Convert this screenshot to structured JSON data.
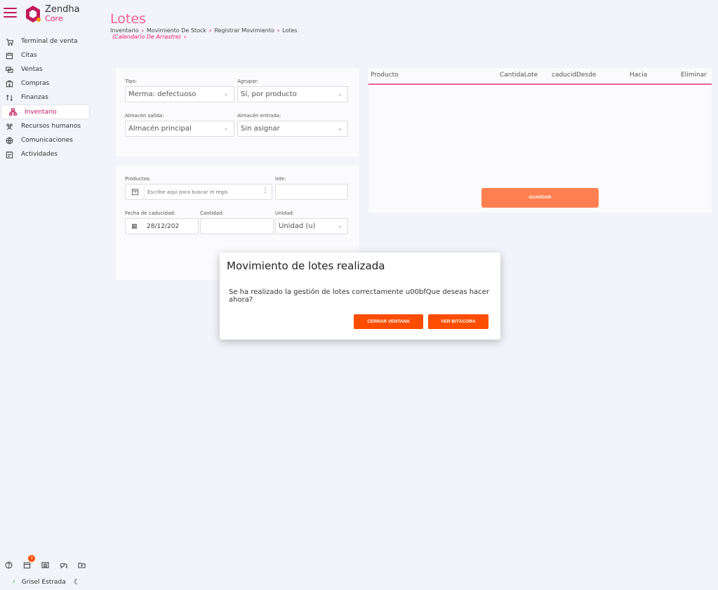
{
  "brand": {
    "name": "Zendha",
    "sub": "Core"
  },
  "nav": [
    {
      "label": "Terminal de venta",
      "icon": "cart-icon"
    },
    {
      "label": "Citas",
      "icon": "calendar-icon"
    },
    {
      "label": "Ventas",
      "icon": "sales-icon"
    },
    {
      "label": "Compras",
      "icon": "purchase-icon"
    },
    {
      "label": "Finanzas",
      "icon": "finance-icon"
    },
    {
      "label": "Inventario",
      "icon": "inventory-icon",
      "active": true
    },
    {
      "label": "Recursos humanos",
      "icon": "people-icon"
    },
    {
      "label": "Comunicaciones",
      "icon": "globe-icon"
    },
    {
      "label": "Actividades",
      "icon": "activities-icon"
    }
  ],
  "footer": {
    "badge_count": "3",
    "user_name": "Grisel Estrada"
  },
  "header": {
    "title": "Lotes",
    "breadcrumb": [
      "Inventario",
      "Movimiento De Stock",
      "Registrar Movimiento",
      "Lotes"
    ],
    "breadcrumb_sub": "(Calendario De Arrastre)"
  },
  "form_top": {
    "tipo_label": "Tipo:",
    "tipo_value": "Merma: defectuoso",
    "agrupar_label": "Agrupar:",
    "agrupar_value": "Sí, por producto",
    "salida_label": "Almacén salida:",
    "salida_value": "Almacén principal",
    "entrada_label": "Almacén entrada:",
    "entrada_value": "Sin asignar"
  },
  "form_bottom": {
    "productos_label": "Productos:",
    "productos_placeholder": "Escribe aquí para buscar el regis",
    "lote_label": "lote:",
    "fecha_label": "Fecha de caducidad:",
    "fecha_value": "28/12/202",
    "cantidad_label": "Cantidad:",
    "unidad_label": "Unidad:",
    "unidad_value": "Unidad (u)"
  },
  "table": {
    "columns": [
      "Producto",
      "CantidaLote",
      "caducidDesde",
      "Hacia",
      "Eliminar"
    ],
    "save_label": "GUARDAR"
  },
  "dialog": {
    "title": "Movimiento de lotes realizada",
    "message": "Se ha realizado la gestión de lotes correctamente u00bfQue deseas hacer ahora?",
    "close_label": "CERRAR VENTANA",
    "log_label": "VER BITÁCORA"
  },
  "colors": {
    "accent": "#e91e63",
    "primary_button": "#ff4d00",
    "save_button": "#ff7f50"
  }
}
